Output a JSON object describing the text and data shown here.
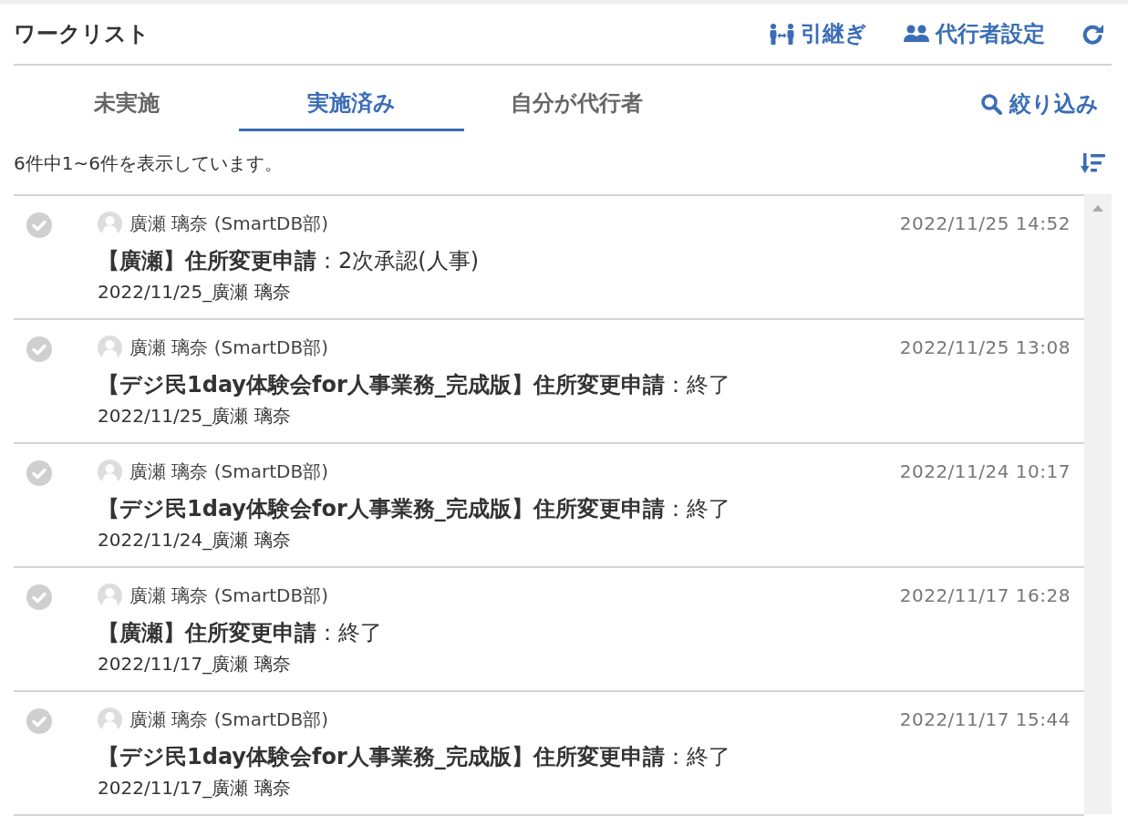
{
  "header": {
    "title": "ワークリスト",
    "actions": [
      {
        "kind": "handover",
        "label": "引継ぎ"
      },
      {
        "kind": "delegate",
        "label": "代行者設定"
      },
      {
        "kind": "refresh"
      }
    ]
  },
  "tabs": [
    {
      "label": "未実施",
      "selected": false
    },
    {
      "label": "実施済み",
      "selected": true
    },
    {
      "label": "自分が代行者",
      "selected": false
    }
  ],
  "filter": {
    "label": "絞り込み"
  },
  "count_text": "6件中1~6件を表示しています。",
  "items": [
    {
      "requester": "廣瀬 璃奈 (SmartDB部)",
      "timestamp": "2022/11/25 14:52",
      "title": "**【廣瀬】住所変更申請**：2次承認(人事)",
      "reference": "2022/11/25_廣瀬 璃奈"
    },
    {
      "requester": "廣瀬 璃奈 (SmartDB部)",
      "timestamp": "2022/11/25 13:08",
      "title": "**【デジ民1day体験会for人事業務_完成版】住所変更申請**：終了",
      "reference": "2022/11/25_廣瀬 璃奈"
    },
    {
      "requester": "廣瀬 璃奈 (SmartDB部)",
      "timestamp": "2022/11/24 10:17",
      "title": "**【デジ民1day体験会for人事業務_完成版】住所変更申請**：終了",
      "reference": "2022/11/24_廣瀬 璃奈"
    },
    {
      "requester": "廣瀬 璃奈 (SmartDB部)",
      "timestamp": "2022/11/17 16:28",
      "title": "**【廣瀬】住所変更申請**：終了",
      "reference": "2022/11/17_廣瀬 璃奈"
    },
    {
      "requester": "廣瀬 璃奈 (SmartDB部)",
      "timestamp": "2022/11/17 15:44",
      "title": "**【デジ民1day体験会for人事業務_完成版】住所変更申請**：終了",
      "reference": "2022/11/17_廣瀬 璃奈"
    }
  ]
}
